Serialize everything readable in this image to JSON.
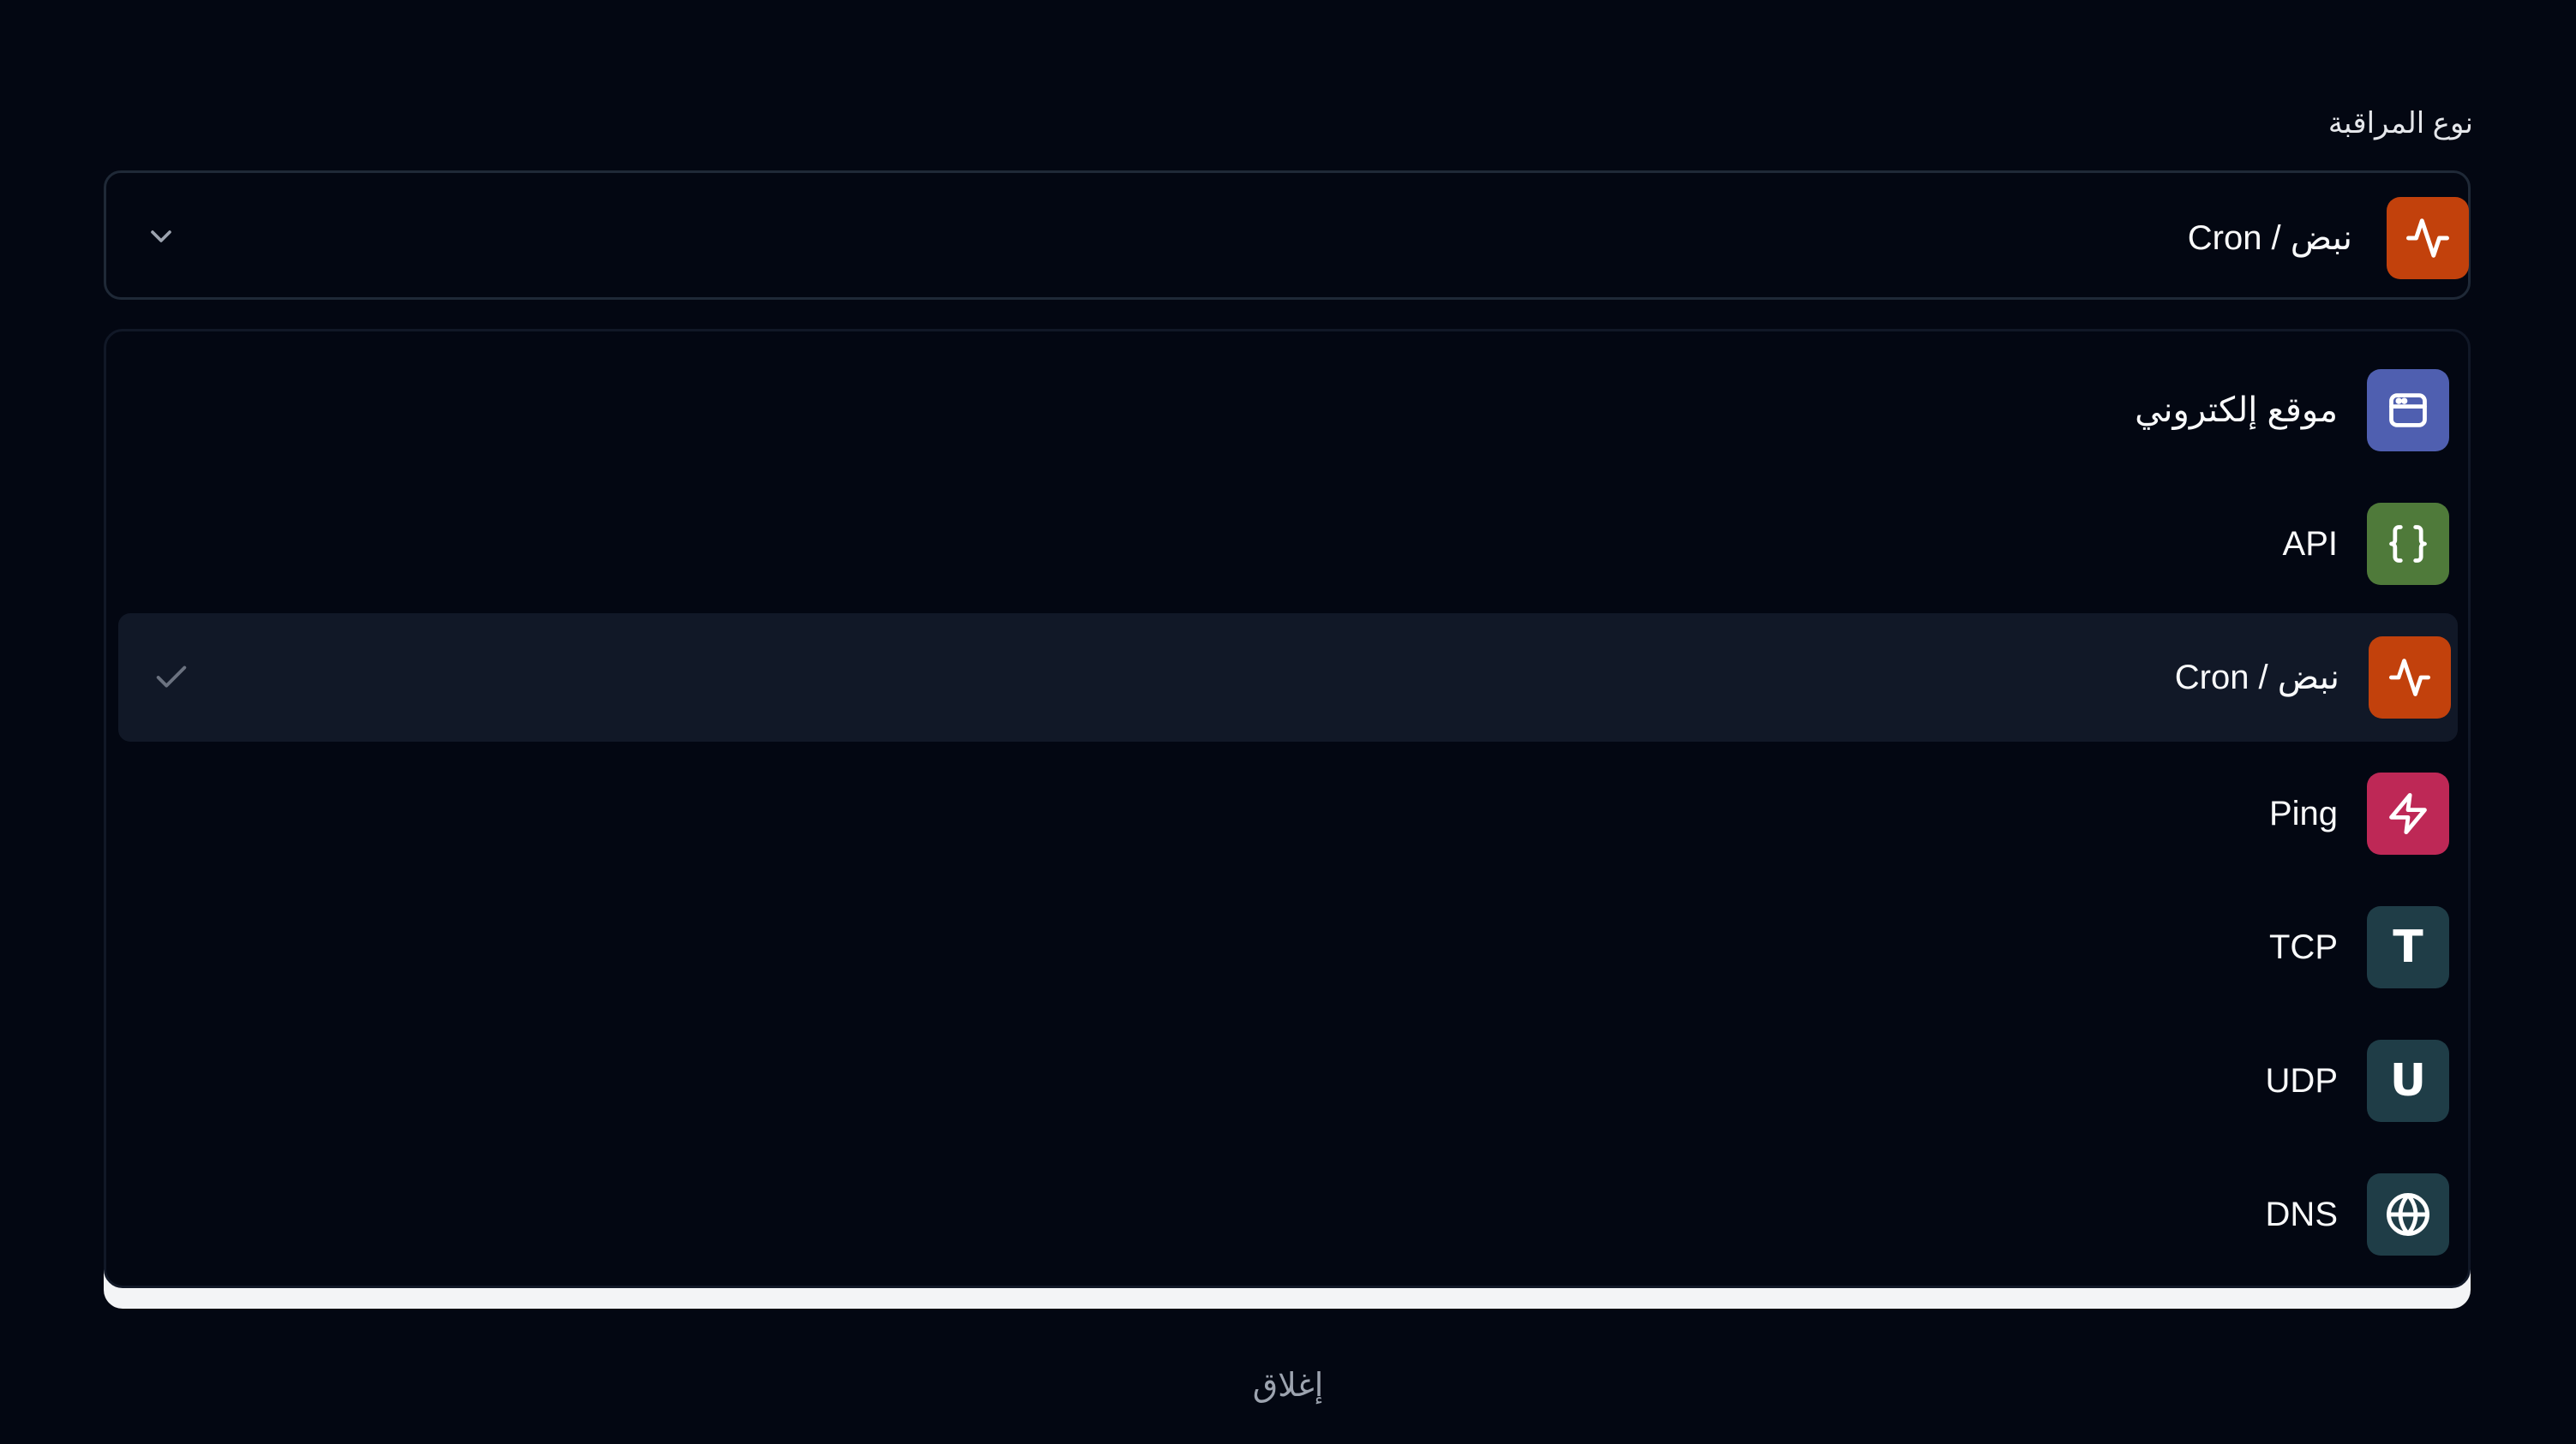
{
  "field": {
    "label": "نوع المراقبة"
  },
  "selected": {
    "label": "Cron / نبض",
    "icon": "activity-icon",
    "color": "#c2410c"
  },
  "options": [
    {
      "label": "موقع إلكتروني",
      "icon": "browser-window-icon",
      "color": "#4f5fb0",
      "selected": false,
      "rtl": true
    },
    {
      "label": "API",
      "icon": "curly-braces-icon",
      "color": "#4f7a3a",
      "selected": false,
      "rtl": false
    },
    {
      "label": "Cron / نبض",
      "icon": "activity-icon",
      "color": "#c2410c",
      "selected": true,
      "rtl": false
    },
    {
      "label": "Ping",
      "icon": "lightning-icon",
      "color": "#be2856",
      "selected": false,
      "rtl": false
    },
    {
      "label": "TCP",
      "icon": "letter-t-icon",
      "glyph": "T",
      "color": "#1f3d47",
      "selected": false,
      "rtl": false
    },
    {
      "label": "UDP",
      "icon": "letter-u-icon",
      "glyph": "U",
      "color": "#1f3d47",
      "selected": false,
      "rtl": false
    },
    {
      "label": "DNS",
      "icon": "globe-icon",
      "color": "#1f3d47",
      "selected": false,
      "rtl": false
    }
  ],
  "actions": {
    "close_label": "إغلاق"
  },
  "colors": {
    "background": "#030712",
    "selected_row": "#111827",
    "border": "#1f2937"
  }
}
